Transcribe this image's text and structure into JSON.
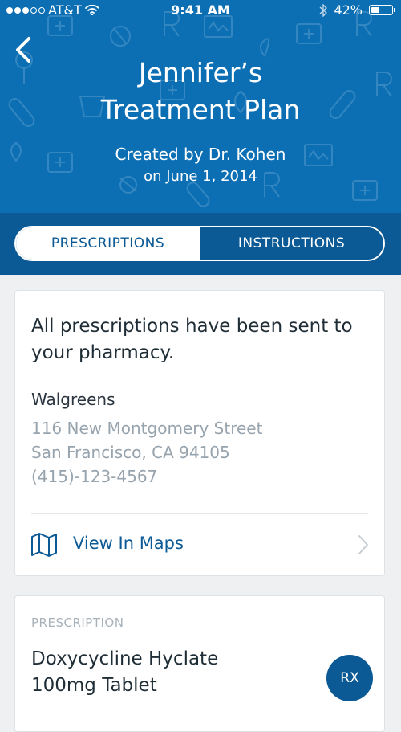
{
  "status_bar": {
    "carrier": "AT&T",
    "time": "9:41 AM",
    "battery": "42%",
    "battery_level": 0.42
  },
  "header": {
    "title_line1": "Jennifer’s",
    "title_line2": "Treatment Plan",
    "created_by": "Created by Dr. Kohen",
    "created_on": "on June 1, 2014"
  },
  "tabs": [
    {
      "label": "PRESCRIPTIONS",
      "active": true
    },
    {
      "label": "INSTRUCTIONS",
      "active": false
    }
  ],
  "pharmacy_card": {
    "headline": "All prescriptions have been sent to your pharmacy.",
    "pharmacy_name": "Walgreens",
    "address_line1": "116 New Montgomery Street",
    "address_line2": "San Francisco, CA 94105",
    "phone": "(415)-123-4567",
    "maps_label": "View In Maps"
  },
  "prescription_card": {
    "caption": "PRESCRIPTION",
    "drug_line1": "Doxycycline Hyclate",
    "drug_line2": "100mg Tablet",
    "badge": "RX"
  },
  "colors": {
    "header_blue": "#0c6fb4",
    "tab_bar_blue": "#0b5a95",
    "accent": "#0b5a95",
    "background": "#eef0f2"
  }
}
